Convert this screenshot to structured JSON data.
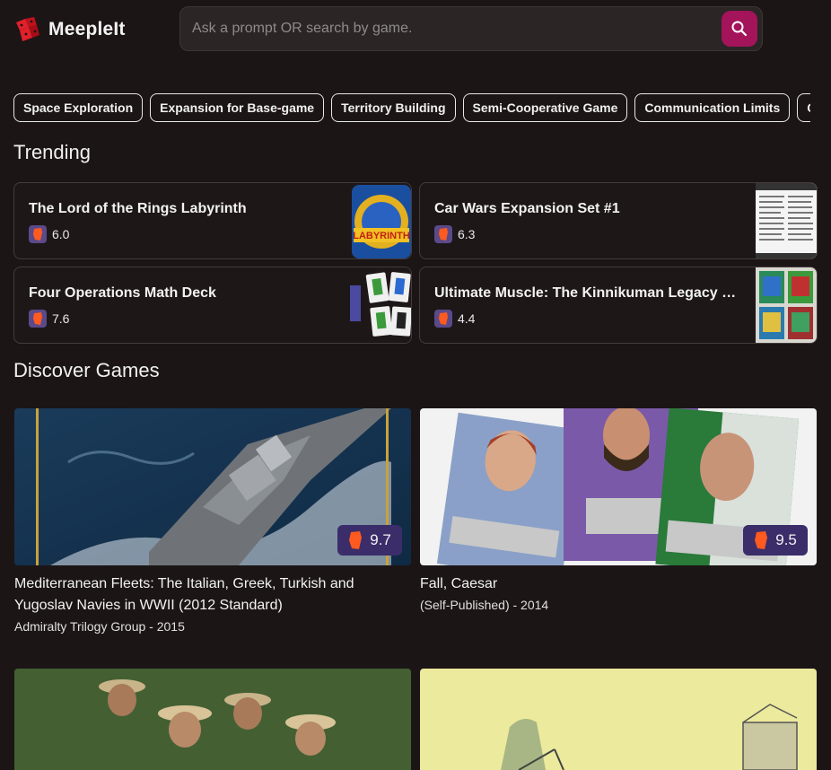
{
  "brand": {
    "name": "MeepleIt"
  },
  "search": {
    "placeholder": "Ask a prompt OR search by game."
  },
  "chips": [
    "Space Exploration",
    "Expansion for Base-game",
    "Territory Building",
    "Semi-Cooperative Game",
    "Communication Limits",
    "Civilization"
  ],
  "trending": {
    "title": "Trending",
    "items": [
      {
        "name": "The Lord of the Rings Labyrinth",
        "rating": "6.0"
      },
      {
        "name": "Car Wars Expansion Set #1",
        "rating": "6.3"
      },
      {
        "name": "Four Operations Math Deck",
        "rating": "7.6"
      },
      {
        "name": "Ultimate Muscle: The Kinnikuman Legacy Bat…",
        "rating": "4.4"
      }
    ]
  },
  "discover": {
    "title": "Discover Games",
    "items": [
      {
        "title": "Mediterranean Fleets: The Italian, Greek, Turkish and Yugoslav Navies in WWII (2012 Standard)",
        "publisher": "Admiralty Trilogy Group - 2015",
        "score": "9.7"
      },
      {
        "title": "Fall, Caesar",
        "publisher": "(Self-Published) - 2014",
        "score": "9.5"
      }
    ]
  },
  "colors": {
    "background": "#1c1516",
    "accent": "#a3145a",
    "score_badge": "#3a2d6a",
    "rating_icon": "#ff5a1f"
  },
  "icons": {
    "logo": "dice-logo-icon",
    "search": "search-icon",
    "rating": "meeple-shield-icon"
  }
}
